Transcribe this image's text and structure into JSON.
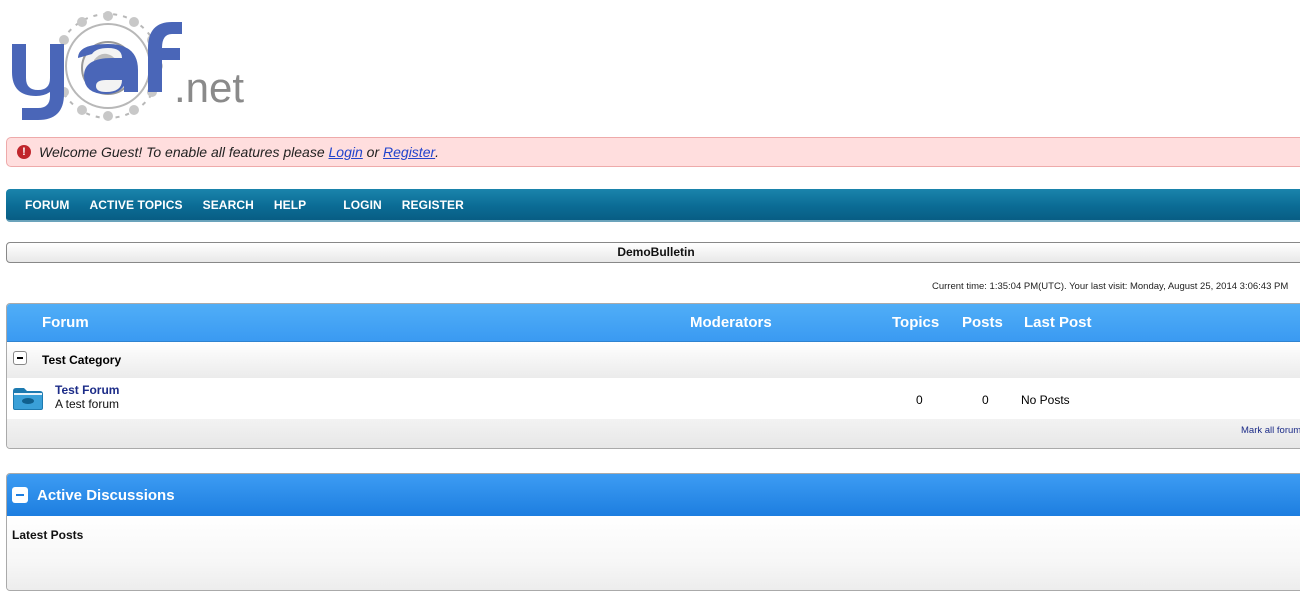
{
  "logo": {
    "text": "yaf.net",
    "icon": "yaf-logo"
  },
  "guest_message": {
    "icon": "exclamation-icon",
    "prefix": "Welcome Guest! To enable all features please ",
    "login_link": "Login",
    "middle": " or ",
    "register_link": "Register",
    "suffix": "."
  },
  "nav": {
    "items": [
      "FORUM",
      "ACTIVE TOPICS",
      "SEARCH",
      "HELP",
      "LOGIN",
      "REGISTER"
    ]
  },
  "board": {
    "name": "DemoBulletin"
  },
  "time_info": "Current time: 1:35:04 PM(UTC). Your last visit: Monday, August 25, 2014 3:06:43 PM",
  "forum_table": {
    "headers": {
      "forum": "Forum",
      "moderators": "Moderators",
      "topics": "Topics",
      "posts": "Posts",
      "last_post": "Last Post"
    },
    "category": {
      "name": "Test Category",
      "toggle": "collapse"
    },
    "forums": [
      {
        "name": "Test Forum",
        "description": "A test forum",
        "topics": "0",
        "posts": "0",
        "last_post": "No Posts",
        "icon": "folder-icon"
      }
    ],
    "footer_link": "Mark all forums as read"
  },
  "active_discussions": {
    "title": "Active Discussions",
    "subtitle": "Latest Posts"
  },
  "colors": {
    "nav": "#0b6c95",
    "header_blue": "#3a9af2",
    "alert_bg": "#ffdede"
  }
}
